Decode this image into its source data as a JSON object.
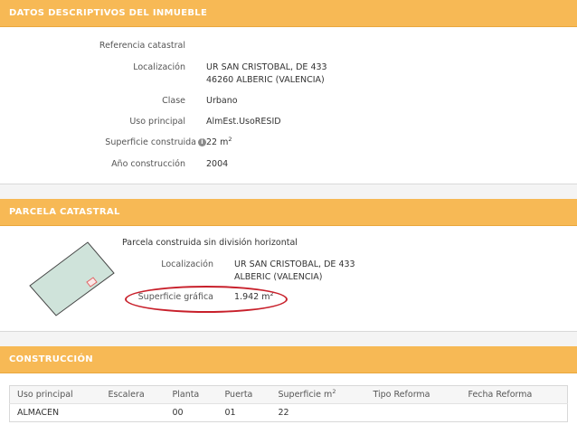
{
  "inmueble": {
    "header": "DATOS DESCRIPTIVOS DEL INMUEBLE",
    "ref_label": "Referencia catastral",
    "ref_value": "",
    "loc_label": "Localización",
    "loc_line1": "UR SAN CRISTOBAL, DE 433",
    "loc_line2": "46260 ALBERIC (VALENCIA)",
    "clase_label": "Clase",
    "clase_value": "Urbano",
    "uso_label": "Uso principal",
    "uso_value": "AlmEst.UsoRESID",
    "sup_label": "Superficie construida",
    "sup_info_icon": "i",
    "sup_value": "22 m",
    "sup_unit_exp": "2",
    "anio_label": "Año construcción",
    "anio_value": "2004"
  },
  "parcela": {
    "header": "PARCELA CATASTRAL",
    "subtitle": "Parcela construida sin división horizontal",
    "loc_label": "Localización",
    "loc_line1": "UR SAN CRISTOBAL, DE 433",
    "loc_line2": "ALBERIC (VALENCIA)",
    "sup_label": "Superficie gráfica",
    "sup_value": "1.942 m",
    "sup_unit_exp": "2",
    "colors": {
      "parcel_fill": "#cfe3da",
      "parcel_stroke": "#444444",
      "building_stroke": "#e06060",
      "highlight": "#c8202b"
    }
  },
  "construccion": {
    "header": "CONSTRUCCIÓN",
    "columns": [
      "Uso principal",
      "Escalera",
      "Planta",
      "Puerta",
      "Superficie m",
      "Tipo Reforma",
      "Fecha Reforma"
    ],
    "sup_col_exp": "2",
    "rows": [
      [
        "ALMACEN",
        "",
        "00",
        "01",
        "22",
        "",
        ""
      ]
    ]
  },
  "colors": {
    "header_bg": "#f7b955",
    "header_text": "#ffffff"
  }
}
